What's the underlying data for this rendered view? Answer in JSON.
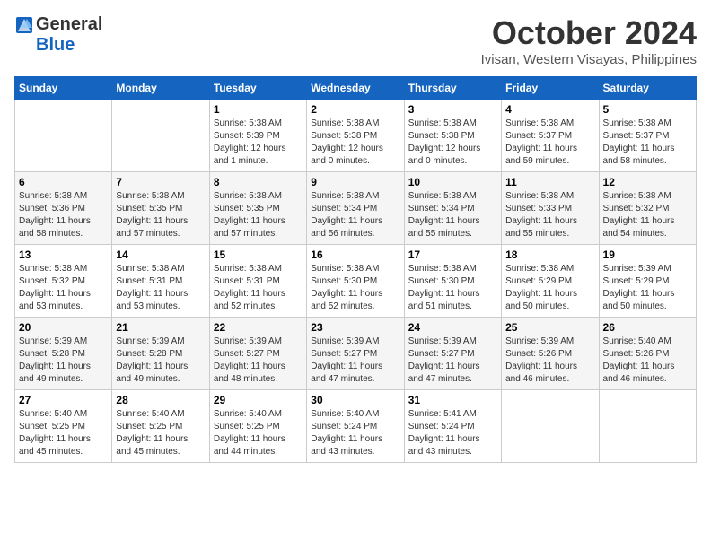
{
  "header": {
    "logo_line1": "General",
    "logo_line2": "Blue",
    "month_title": "October 2024",
    "location": "Ivisan, Western Visayas, Philippines"
  },
  "weekdays": [
    "Sunday",
    "Monday",
    "Tuesday",
    "Wednesday",
    "Thursday",
    "Friday",
    "Saturday"
  ],
  "weeks": [
    [
      {
        "day": "",
        "info": ""
      },
      {
        "day": "",
        "info": ""
      },
      {
        "day": "1",
        "info": "Sunrise: 5:38 AM\nSunset: 5:39 PM\nDaylight: 12 hours\nand 1 minute."
      },
      {
        "day": "2",
        "info": "Sunrise: 5:38 AM\nSunset: 5:38 PM\nDaylight: 12 hours\nand 0 minutes."
      },
      {
        "day": "3",
        "info": "Sunrise: 5:38 AM\nSunset: 5:38 PM\nDaylight: 12 hours\nand 0 minutes."
      },
      {
        "day": "4",
        "info": "Sunrise: 5:38 AM\nSunset: 5:37 PM\nDaylight: 11 hours\nand 59 minutes."
      },
      {
        "day": "5",
        "info": "Sunrise: 5:38 AM\nSunset: 5:37 PM\nDaylight: 11 hours\nand 58 minutes."
      }
    ],
    [
      {
        "day": "6",
        "info": "Sunrise: 5:38 AM\nSunset: 5:36 PM\nDaylight: 11 hours\nand 58 minutes."
      },
      {
        "day": "7",
        "info": "Sunrise: 5:38 AM\nSunset: 5:35 PM\nDaylight: 11 hours\nand 57 minutes."
      },
      {
        "day": "8",
        "info": "Sunrise: 5:38 AM\nSunset: 5:35 PM\nDaylight: 11 hours\nand 57 minutes."
      },
      {
        "day": "9",
        "info": "Sunrise: 5:38 AM\nSunset: 5:34 PM\nDaylight: 11 hours\nand 56 minutes."
      },
      {
        "day": "10",
        "info": "Sunrise: 5:38 AM\nSunset: 5:34 PM\nDaylight: 11 hours\nand 55 minutes."
      },
      {
        "day": "11",
        "info": "Sunrise: 5:38 AM\nSunset: 5:33 PM\nDaylight: 11 hours\nand 55 minutes."
      },
      {
        "day": "12",
        "info": "Sunrise: 5:38 AM\nSunset: 5:32 PM\nDaylight: 11 hours\nand 54 minutes."
      }
    ],
    [
      {
        "day": "13",
        "info": "Sunrise: 5:38 AM\nSunset: 5:32 PM\nDaylight: 11 hours\nand 53 minutes."
      },
      {
        "day": "14",
        "info": "Sunrise: 5:38 AM\nSunset: 5:31 PM\nDaylight: 11 hours\nand 53 minutes."
      },
      {
        "day": "15",
        "info": "Sunrise: 5:38 AM\nSunset: 5:31 PM\nDaylight: 11 hours\nand 52 minutes."
      },
      {
        "day": "16",
        "info": "Sunrise: 5:38 AM\nSunset: 5:30 PM\nDaylight: 11 hours\nand 52 minutes."
      },
      {
        "day": "17",
        "info": "Sunrise: 5:38 AM\nSunset: 5:30 PM\nDaylight: 11 hours\nand 51 minutes."
      },
      {
        "day": "18",
        "info": "Sunrise: 5:38 AM\nSunset: 5:29 PM\nDaylight: 11 hours\nand 50 minutes."
      },
      {
        "day": "19",
        "info": "Sunrise: 5:39 AM\nSunset: 5:29 PM\nDaylight: 11 hours\nand 50 minutes."
      }
    ],
    [
      {
        "day": "20",
        "info": "Sunrise: 5:39 AM\nSunset: 5:28 PM\nDaylight: 11 hours\nand 49 minutes."
      },
      {
        "day": "21",
        "info": "Sunrise: 5:39 AM\nSunset: 5:28 PM\nDaylight: 11 hours\nand 49 minutes."
      },
      {
        "day": "22",
        "info": "Sunrise: 5:39 AM\nSunset: 5:27 PM\nDaylight: 11 hours\nand 48 minutes."
      },
      {
        "day": "23",
        "info": "Sunrise: 5:39 AM\nSunset: 5:27 PM\nDaylight: 11 hours\nand 47 minutes."
      },
      {
        "day": "24",
        "info": "Sunrise: 5:39 AM\nSunset: 5:27 PM\nDaylight: 11 hours\nand 47 minutes."
      },
      {
        "day": "25",
        "info": "Sunrise: 5:39 AM\nSunset: 5:26 PM\nDaylight: 11 hours\nand 46 minutes."
      },
      {
        "day": "26",
        "info": "Sunrise: 5:40 AM\nSunset: 5:26 PM\nDaylight: 11 hours\nand 46 minutes."
      }
    ],
    [
      {
        "day": "27",
        "info": "Sunrise: 5:40 AM\nSunset: 5:25 PM\nDaylight: 11 hours\nand 45 minutes."
      },
      {
        "day": "28",
        "info": "Sunrise: 5:40 AM\nSunset: 5:25 PM\nDaylight: 11 hours\nand 45 minutes."
      },
      {
        "day": "29",
        "info": "Sunrise: 5:40 AM\nSunset: 5:25 PM\nDaylight: 11 hours\nand 44 minutes."
      },
      {
        "day": "30",
        "info": "Sunrise: 5:40 AM\nSunset: 5:24 PM\nDaylight: 11 hours\nand 43 minutes."
      },
      {
        "day": "31",
        "info": "Sunrise: 5:41 AM\nSunset: 5:24 PM\nDaylight: 11 hours\nand 43 minutes."
      },
      {
        "day": "",
        "info": ""
      },
      {
        "day": "",
        "info": ""
      }
    ]
  ]
}
